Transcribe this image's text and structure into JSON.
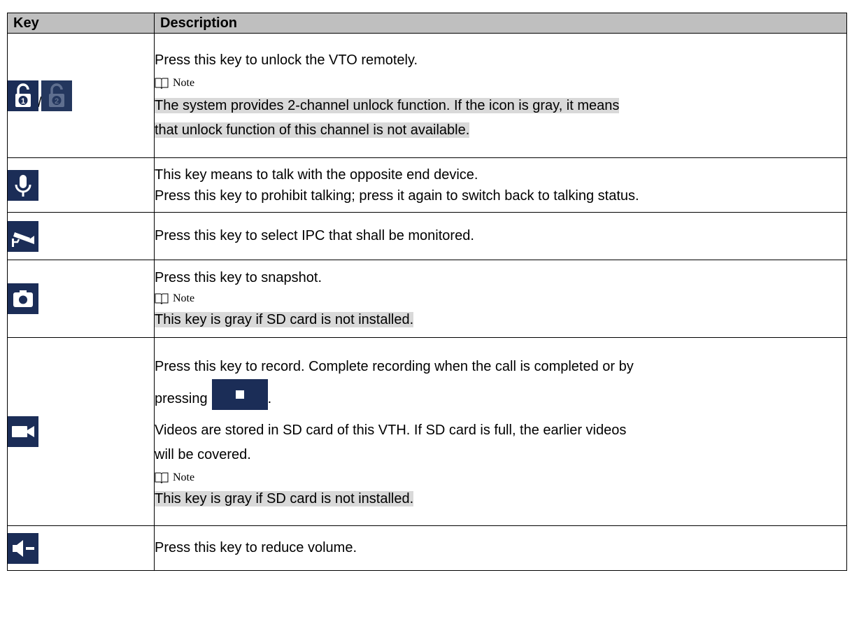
{
  "header": {
    "key": "Key",
    "description": "Description"
  },
  "rows": [
    {
      "icons": [
        "unlock-1-icon",
        "unlock-2-icon"
      ],
      "separator": "/",
      "lines": [
        "Press this key to unlock the VTO remotely."
      ],
      "note_label": "Note",
      "note_lines": [
        "The system provides 2-channel unlock function. If the icon is gray, it means",
        "that unlock function of this channel is not available."
      ]
    },
    {
      "icons": [
        "microphone-icon"
      ],
      "lines": [
        "This key means to talk with the opposite end device.",
        "Press this key to prohibit talking; press it again to switch back to talking status."
      ]
    },
    {
      "icons": [
        "security-camera-icon"
      ],
      "lines": [
        "Press this key to select IPC that shall be monitored."
      ]
    },
    {
      "icons": [
        "camera-icon"
      ],
      "lines": [
        "Press this key to snapshot."
      ],
      "note_label": "Note",
      "note_lines": [
        "This key is gray if SD card is not installed."
      ]
    },
    {
      "icons": [
        "video-camera-icon"
      ],
      "line1": "Press this key to record. Complete recording when the call is completed or by",
      "line2_prefix": "pressing",
      "line2_suffix": ".",
      "inline_icon": "stop-icon",
      "line3": "Videos are stored in SD card of this VTH. If SD card is full, the earlier videos",
      "line4": "will be covered.",
      "note_label": "Note",
      "note_lines": [
        "This key is gray if SD card is not installed."
      ]
    },
    {
      "icons": [
        "volume-down-icon"
      ],
      "lines": [
        "Press this key to reduce volume."
      ]
    }
  ],
  "colors": {
    "icon_bg": "#1b2d57",
    "header_bg": "#bfbfbf",
    "highlight": "#d9d9d9"
  }
}
